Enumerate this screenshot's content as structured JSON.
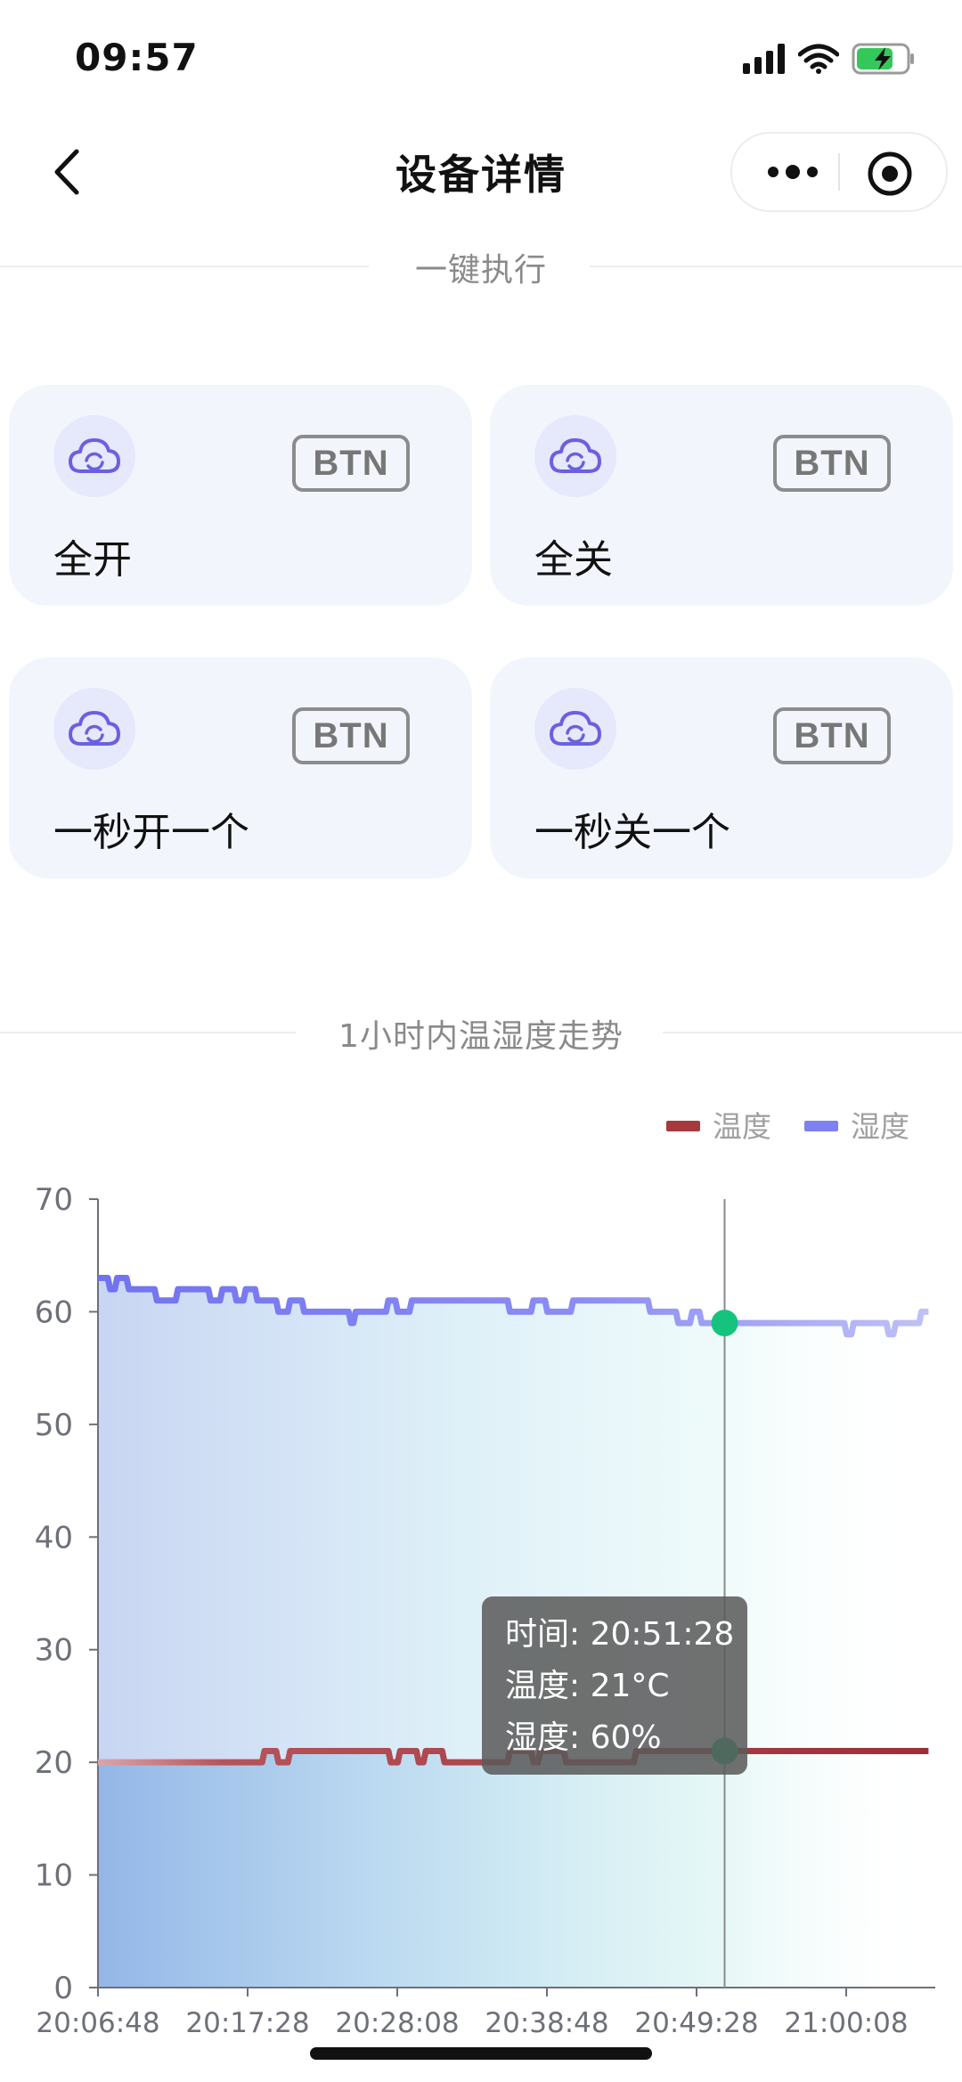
{
  "status_bar": {
    "time": "09:57"
  },
  "nav": {
    "title": "设备详情"
  },
  "sections": {
    "quick_actions": "一键执行",
    "trend": "1小时内温湿度走势"
  },
  "actions": [
    {
      "label": "全开",
      "badge": "BTN"
    },
    {
      "label": "全关",
      "badge": "BTN"
    },
    {
      "label": "一秒开一个",
      "badge": "BTN"
    },
    {
      "label": "一秒关一个",
      "badge": "BTN"
    }
  ],
  "colors": {
    "temperature": "#a73a3f",
    "humidity": "#7f80f2",
    "accent": "#16c37e",
    "icon": "#6a60e0"
  },
  "tooltip": {
    "time_line": "时间: 20:51:28",
    "temp_line": "温度: 21°C",
    "hum_line": "湿度: 60%"
  },
  "chart_data": {
    "type": "line",
    "x_ticks": [
      "20:06:48",
      "20:17:28",
      "20:28:08",
      "20:38:48",
      "20:49:28",
      "21:00:08"
    ],
    "ylim": [
      0,
      70
    ],
    "y_ticks": [
      0,
      10,
      20,
      30,
      40,
      50,
      60,
      70
    ],
    "legend": "top-right",
    "highlight_time": "20:51:28",
    "series": [
      {
        "name": "温度",
        "color": "#a73a3f",
        "points": [
          [
            "20:06:48",
            20
          ],
          [
            "20:18:30",
            20
          ],
          [
            "20:18:40",
            21
          ],
          [
            "20:19:30",
            21
          ],
          [
            "20:19:40",
            20
          ],
          [
            "20:20:20",
            20
          ],
          [
            "20:20:30",
            21
          ],
          [
            "20:27:30",
            21
          ],
          [
            "20:27:40",
            20
          ],
          [
            "20:28:10",
            20
          ],
          [
            "20:28:20",
            21
          ],
          [
            "20:29:30",
            21
          ],
          [
            "20:29:40",
            20
          ],
          [
            "20:30:00",
            20
          ],
          [
            "20:30:10",
            21
          ],
          [
            "20:31:20",
            21
          ],
          [
            "20:31:30",
            20
          ],
          [
            "20:36:00",
            20
          ],
          [
            "20:36:10",
            21
          ],
          [
            "20:37:40",
            21
          ],
          [
            "20:37:50",
            20
          ],
          [
            "20:38:10",
            20
          ],
          [
            "20:38:20",
            21
          ],
          [
            "20:40:00",
            21
          ],
          [
            "20:40:10",
            20
          ],
          [
            "20:45:00",
            20
          ],
          [
            "20:45:10",
            21
          ],
          [
            "21:06:00",
            21
          ]
        ]
      },
      {
        "name": "湿度",
        "color": "#7f80f2",
        "points": [
          [
            "20:06:48",
            63
          ],
          [
            "20:07:30",
            63
          ],
          [
            "20:07:40",
            62
          ],
          [
            "20:08:00",
            62
          ],
          [
            "20:08:10",
            63
          ],
          [
            "20:08:50",
            63
          ],
          [
            "20:09:00",
            62
          ],
          [
            "20:10:50",
            62
          ],
          [
            "20:11:00",
            61
          ],
          [
            "20:12:20",
            61
          ],
          [
            "20:12:30",
            62
          ],
          [
            "20:14:40",
            62
          ],
          [
            "20:14:50",
            61
          ],
          [
            "20:15:30",
            61
          ],
          [
            "20:15:40",
            62
          ],
          [
            "20:16:30",
            62
          ],
          [
            "20:16:40",
            61
          ],
          [
            "20:17:10",
            61
          ],
          [
            "20:17:20",
            62
          ],
          [
            "20:18:00",
            62
          ],
          [
            "20:18:10",
            61
          ],
          [
            "20:19:30",
            61
          ],
          [
            "20:19:40",
            60
          ],
          [
            "20:20:20",
            60
          ],
          [
            "20:20:30",
            61
          ],
          [
            "20:21:20",
            61
          ],
          [
            "20:21:30",
            60
          ],
          [
            "20:24:40",
            60
          ],
          [
            "20:24:50",
            59
          ],
          [
            "20:25:00",
            59
          ],
          [
            "20:25:10",
            60
          ],
          [
            "20:27:20",
            60
          ],
          [
            "20:27:30",
            61
          ],
          [
            "20:28:00",
            61
          ],
          [
            "20:28:10",
            60
          ],
          [
            "20:29:00",
            60
          ],
          [
            "20:29:10",
            61
          ],
          [
            "20:36:00",
            61
          ],
          [
            "20:36:10",
            60
          ],
          [
            "20:37:40",
            60
          ],
          [
            "20:37:50",
            61
          ],
          [
            "20:38:40",
            61
          ],
          [
            "20:38:50",
            60
          ],
          [
            "20:40:30",
            60
          ],
          [
            "20:40:40",
            61
          ],
          [
            "20:46:00",
            61
          ],
          [
            "20:46:10",
            60
          ],
          [
            "20:48:00",
            60
          ],
          [
            "20:48:10",
            59
          ],
          [
            "20:49:00",
            59
          ],
          [
            "20:49:10",
            60
          ],
          [
            "20:49:40",
            60
          ],
          [
            "20:49:50",
            59
          ],
          [
            "21:00:00",
            59
          ],
          [
            "21:00:10",
            58
          ],
          [
            "21:00:30",
            58
          ],
          [
            "21:00:40",
            59
          ],
          [
            "21:03:00",
            59
          ],
          [
            "21:03:10",
            58
          ],
          [
            "21:03:30",
            58
          ],
          [
            "21:03:40",
            59
          ],
          [
            "21:05:20",
            59
          ],
          [
            "21:05:30",
            60
          ],
          [
            "21:06:00",
            60
          ]
        ]
      }
    ]
  }
}
